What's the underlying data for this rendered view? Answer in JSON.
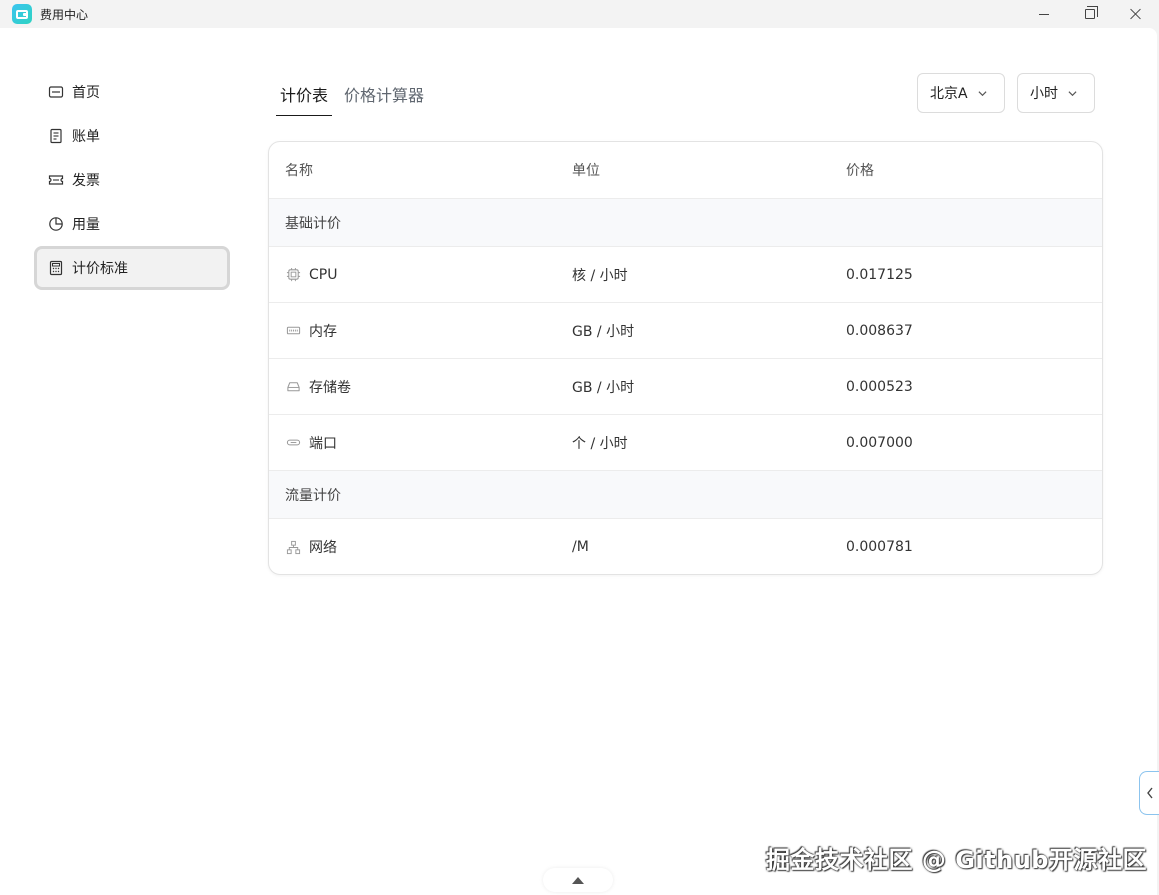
{
  "window": {
    "title": "费用中心"
  },
  "sidebar": {
    "items": [
      {
        "label": "首页",
        "icon": "home-icon"
      },
      {
        "label": "账单",
        "icon": "bill-icon"
      },
      {
        "label": "发票",
        "icon": "invoice-icon"
      },
      {
        "label": "用量",
        "icon": "pie-chart-icon"
      },
      {
        "label": "计价标准",
        "icon": "calculator-icon",
        "active": true
      }
    ]
  },
  "tabs": [
    {
      "label": "计价表",
      "active": true
    },
    {
      "label": "价格计算器",
      "active": false
    }
  ],
  "filters": {
    "region": "北京A",
    "time_unit": "小时"
  },
  "table": {
    "headers": {
      "name": "名称",
      "unit": "单位",
      "price": "价格"
    },
    "groups": [
      {
        "label": "基础计价",
        "rows": [
          {
            "icon": "cpu-icon",
            "name": "CPU",
            "unit": "核 / 小时",
            "price": "0.017125"
          },
          {
            "icon": "memory-icon",
            "name": "内存",
            "unit": "GB / 小时",
            "price": "0.008637"
          },
          {
            "icon": "disk-icon",
            "name": "存储卷",
            "unit": "GB / 小时",
            "price": "0.000523"
          },
          {
            "icon": "port-icon",
            "name": "端口",
            "unit": "个 / 小时",
            "price": "0.007000"
          }
        ]
      },
      {
        "label": "流量计价",
        "rows": [
          {
            "icon": "network-icon",
            "name": "网络",
            "unit": "/M",
            "price": "0.000781"
          }
        ]
      }
    ]
  },
  "watermark": "掘金技术社区 @ Github开源社区",
  "colors": {
    "accent_border": "#8cc4ee",
    "active_nav_bg": "#f2f2f2",
    "group_row_bg": "#f8f9fb"
  }
}
